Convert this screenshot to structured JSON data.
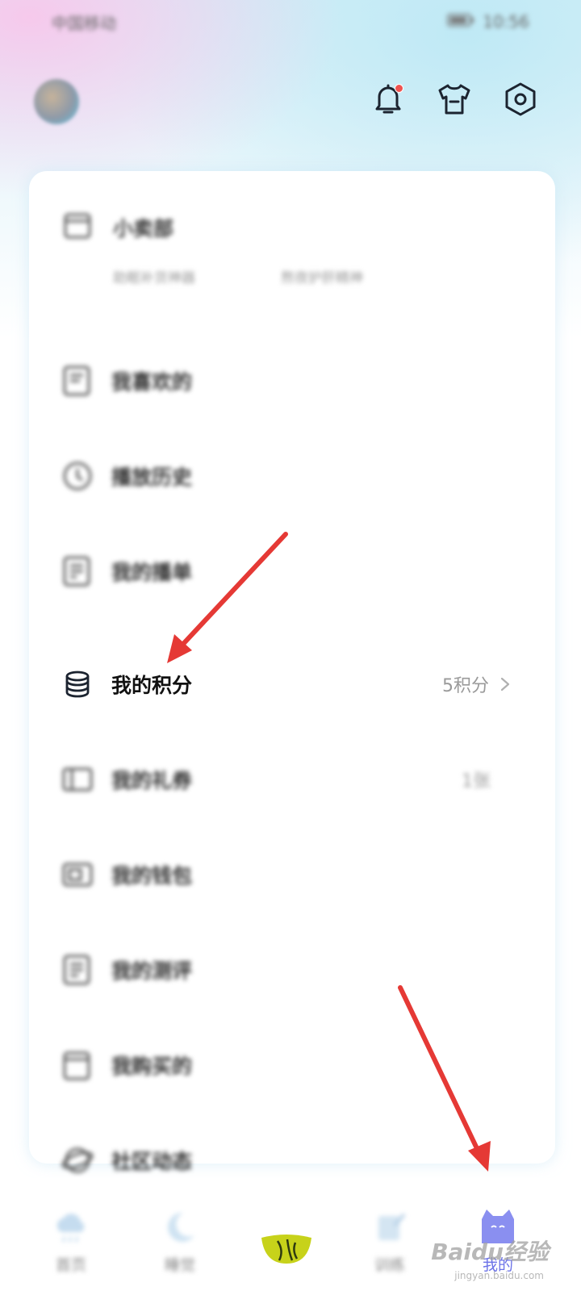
{
  "status_bar": {
    "carrier": "中国移动",
    "time": "10:56"
  },
  "header": {
    "avatar": "user-avatar",
    "icons": [
      "bell-icon",
      "tshirt-icon",
      "settings-icon"
    ]
  },
  "shop": {
    "label": "小卖部",
    "sub_left": "助眠补货神器",
    "sub_right": "熬夜护肝精神"
  },
  "menu": [
    {
      "label": "我喜欢的",
      "icon": "heart-list-icon",
      "value": ""
    },
    {
      "label": "播放历史",
      "icon": "clock-icon",
      "value": ""
    },
    {
      "label": "我的播单",
      "icon": "playlist-icon",
      "value": ""
    },
    {
      "label": "我的积分",
      "icon": "coins-icon",
      "value": "5积分"
    },
    {
      "label": "我的礼券",
      "icon": "coupon-icon",
      "value": "1张"
    },
    {
      "label": "我的钱包",
      "icon": "wallet-icon",
      "value": ""
    },
    {
      "label": "我的测评",
      "icon": "assessment-icon",
      "value": ""
    },
    {
      "label": "我购买的",
      "icon": "purchased-icon",
      "value": ""
    },
    {
      "label": "社区动态",
      "icon": "community-icon",
      "value": ""
    }
  ],
  "bottom_nav": [
    {
      "label": "首页",
      "icon": "home-cloud-icon"
    },
    {
      "label": "睡觉",
      "icon": "moon-icon"
    },
    {
      "label": "",
      "icon": "center-play-icon"
    },
    {
      "label": "训练",
      "icon": "training-icon"
    },
    {
      "label": "我的",
      "icon": "profile-cat-icon"
    }
  ],
  "colors": {
    "accent": "#6b72e8",
    "annotation": "#e53935",
    "notification_dot": "#ef5350"
  },
  "watermark": {
    "text": "Baidu经验",
    "sub": "jingyan.baidu.com"
  }
}
